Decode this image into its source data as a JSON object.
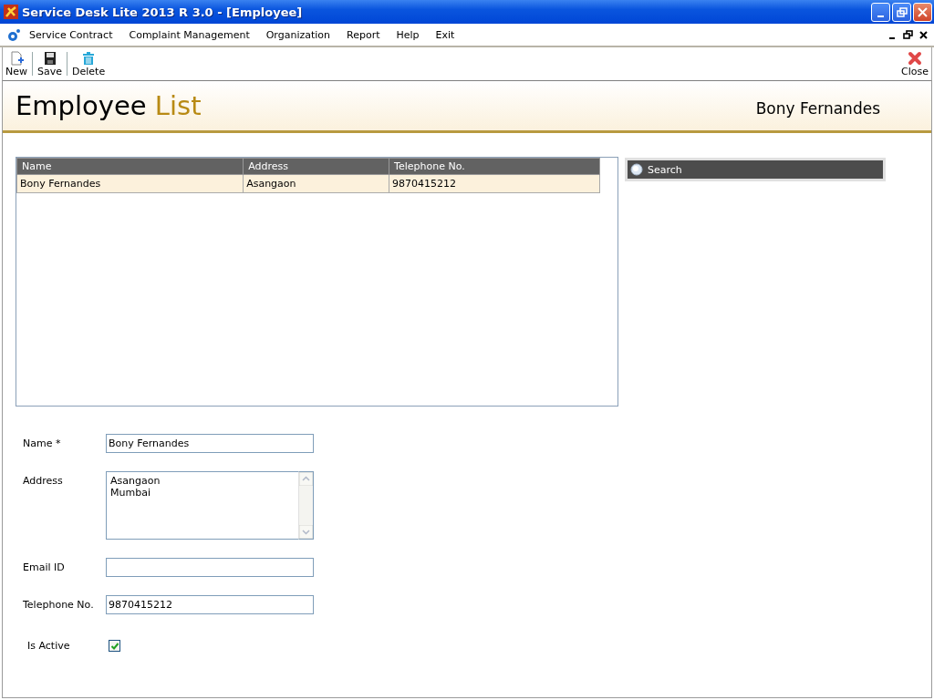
{
  "window": {
    "title": "Service Desk Lite 2013 R 3.0 - [Employee]"
  },
  "menu": [
    "Service Contract",
    "Complaint Management",
    "Organization",
    "Report",
    "Help",
    "Exit"
  ],
  "toolbar": [
    {
      "kind": "new",
      "label": "New"
    },
    {
      "kind": "save",
      "label": "Save"
    },
    {
      "kind": "delete",
      "label": "Delete"
    },
    {
      "kind": "close",
      "label": "Close"
    }
  ],
  "header": {
    "title": "Employee",
    "title_accent": "List",
    "user": "Bony Fernandes"
  },
  "table": {
    "columns": [
      "Name",
      "Address",
      "Telephone No."
    ],
    "rows": [
      {
        "cells": [
          "Bony Fernandes",
          "Asangaon",
          "9870415212"
        ],
        "selected": true
      }
    ]
  },
  "search": {
    "label": "Search"
  },
  "form": {
    "fields": [
      {
        "kind": "text",
        "label": "Name *",
        "value": "Bony Fernandes"
      },
      {
        "kind": "textarea",
        "label": "Address",
        "value": "Asangaon\nMumbai"
      },
      {
        "kind": "text",
        "label": "Email ID"
      },
      {
        "kind": "text",
        "label": "Telephone No.",
        "value": "9870415212"
      },
      {
        "kind": "checkbox",
        "label": "Is Active",
        "checked": true
      }
    ]
  }
}
